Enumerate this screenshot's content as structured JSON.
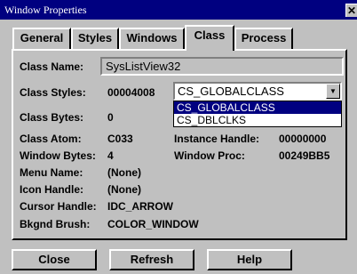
{
  "window": {
    "title": "Window Properties",
    "close_glyph": "✕"
  },
  "tabs": [
    {
      "label": "General",
      "active": false
    },
    {
      "label": "Styles",
      "active": false
    },
    {
      "label": "Windows",
      "active": false
    },
    {
      "label": "Class",
      "active": true
    },
    {
      "label": "Process",
      "active": false
    }
  ],
  "class_tab": {
    "class_name_label": "Class Name:",
    "class_name_value": "SysListView32",
    "class_styles_label": "Class Styles:",
    "class_styles_value": "00004008",
    "class_styles_combo": {
      "selected": "CS_GLOBALCLASS",
      "options": [
        "CS_GLOBALCLASS",
        "CS_DBLCLKS"
      ],
      "highlighted": "CS_GLOBALCLASS"
    },
    "class_bytes_label": "Class Bytes:",
    "class_bytes_value": "0",
    "class_atom_label": "Class Atom:",
    "class_atom_value": "C033",
    "instance_handle_label": "Instance Handle:",
    "instance_handle_value": "00000000",
    "window_bytes_label": "Window Bytes:",
    "window_bytes_value": "4",
    "window_proc_label": "Window Proc:",
    "window_proc_value": "00249BB5",
    "menu_name_label": "Menu Name:",
    "menu_name_value": "(None)",
    "icon_handle_label": "Icon Handle:",
    "icon_handle_value": "(None)",
    "cursor_handle_label": "Cursor Handle:",
    "cursor_handle_value": "IDC_ARROW",
    "bkgnd_brush_label": "Bkgnd Brush:",
    "bkgnd_brush_value": "COLOR_WINDOW"
  },
  "buttons": {
    "close": "Close",
    "refresh": "Refresh",
    "help": "Help"
  },
  "colors": {
    "titlebar": "#000080",
    "face": "#c0c0c0",
    "highlight": "#000080"
  }
}
